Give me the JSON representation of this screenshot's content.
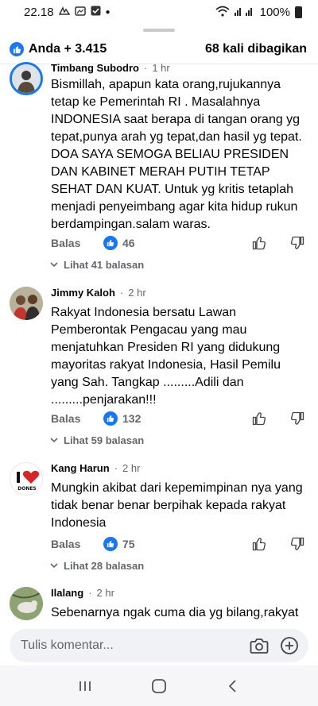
{
  "status_bar": {
    "time": "22.18",
    "battery": "100%"
  },
  "summary": {
    "reactions": "Anda + 3.415",
    "shares": "68 kali dibagikan"
  },
  "comments": [
    {
      "author": "Timbang Subodro",
      "time": "1 hr",
      "text": "Bismillah, apapun kata orang,rujukannya tetap ke Pemerintah RI . Masalahnya INDONESIA saat berapa di tangan orang yg tepat,punya arah yg tepat,dan hasil yg tepat. DOA SAYA SEMOGA BELIAU PRESIDEN DAN KABINET MERAH PUTIH TETAP SEHAT DAN KUAT. Untuk yg kritis tetaplah menjadi penyeimbang agar kita hidup rukun berdampingan.salam waras.",
      "reply_label": "Balas",
      "likes": "46",
      "replies": "Lihat 41 balasan"
    },
    {
      "author": "Jimmy Kaloh",
      "time": "2 hr",
      "text": "Rakyat Indonesia bersatu Lawan Pemberontak Pengacau yang mau menjatuhkan Presiden RI yang didukung mayoritas rakyat Indonesia, Hasil Pemilu yang Sah. Tangkap  .........Adili dan .........penjarakan!!!",
      "reply_label": "Balas",
      "likes": "132",
      "replies": "Lihat 59 balasan"
    },
    {
      "author": "Kang Harun",
      "time": "2 hr",
      "avatar_text": "I ❤ INDONESIA",
      "text": "Mungkin akibat dari kepemimpinan nya yang tidak benar benar berpihak kepada rakyat Indonesia",
      "reply_label": "Balas",
      "likes": "75",
      "replies": "Lihat 28 balasan"
    },
    {
      "author": "Ilalang",
      "time": "2 hr",
      "text": "Sebenarnya ngak cuma dia yg bilang,rakyat"
    }
  ],
  "composer": {
    "placeholder": "Tulis komentar..."
  },
  "colors": {
    "accent": "#1877f2",
    "secondary_text": "#65676b",
    "composer_bg": "#f0f2f5"
  }
}
